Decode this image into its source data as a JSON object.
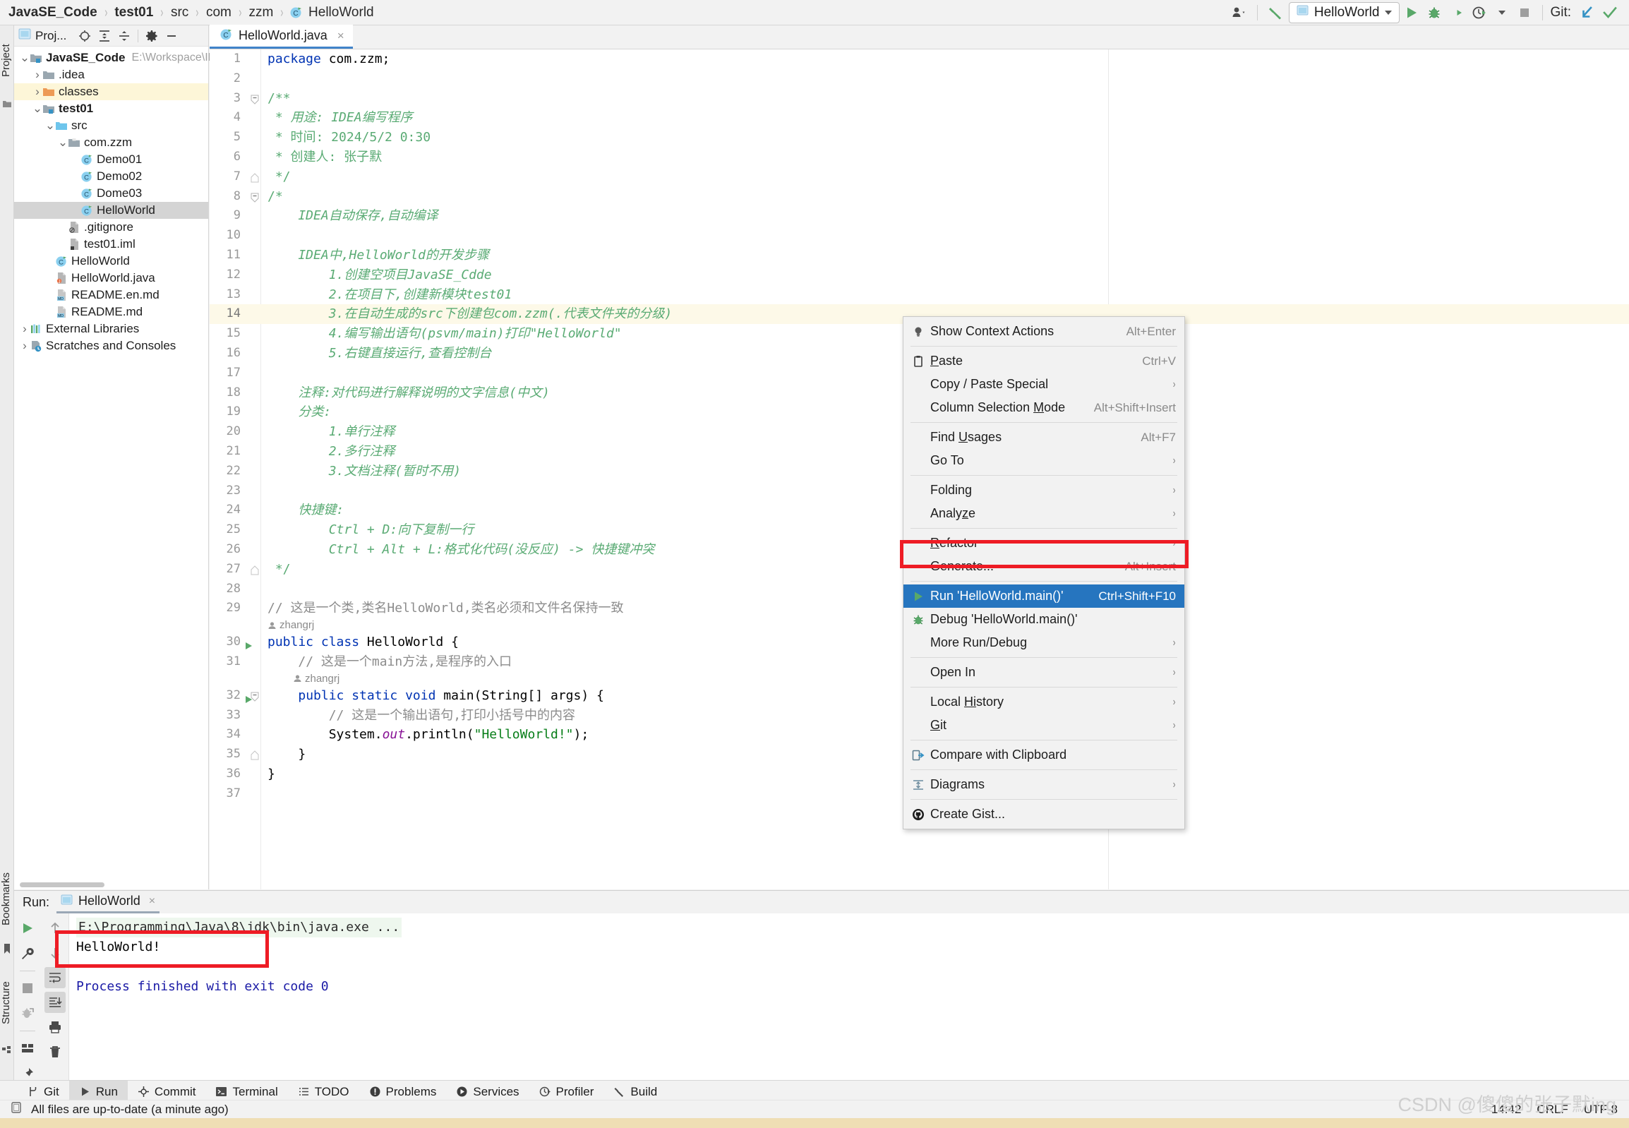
{
  "breadcrumb": {
    "items": [
      {
        "label": "JavaSE_Code",
        "bold": true,
        "icon": ""
      },
      {
        "label": "test01",
        "bold": true,
        "icon": ""
      },
      {
        "label": "src",
        "bold": false,
        "icon": ""
      },
      {
        "label": "com",
        "bold": false,
        "icon": ""
      },
      {
        "label": "zzm",
        "bold": false,
        "icon": ""
      },
      {
        "label": "HelloWorld",
        "bold": false,
        "icon": "java-class-icon"
      }
    ]
  },
  "toolbar": {
    "avatar_icon": "user-dropdown-icon",
    "build_icon": "build-hammer-icon",
    "run_config_name": "HelloWorld",
    "run_config_icon": "run-config-icon",
    "run_icon": "run-play-icon",
    "debug_icon": "debug-bug-icon",
    "run_coverage_icon": "run-with-coverage-icon",
    "profiler_icon": "profiler-icon",
    "stop_icon": "stop-icon",
    "git_label": "Git:",
    "git_update_icon": "git-update-arrow-icon",
    "git_commit_icon": "git-commit-check-icon"
  },
  "left_strip": {
    "project_label": "Project",
    "bookmarks_label": "Bookmarks",
    "structure_label": "Structure"
  },
  "project_panel": {
    "title": "Proj...",
    "title_icon": "project-window-icon",
    "buttons": [
      {
        "name": "select-opened-file-icon",
        "glyph": "target"
      },
      {
        "name": "expand-all-icon",
        "glyph": "expand"
      },
      {
        "name": "collapse-all-icon",
        "glyph": "collapse"
      },
      {
        "name": "settings-gear-icon",
        "glyph": "gear"
      },
      {
        "name": "hide-panel-icon",
        "glyph": "minus"
      }
    ],
    "tree": [
      {
        "indent": 0,
        "arrow": "down",
        "icon": "module-folder-icon",
        "label": "JavaSE_Code",
        "bold": true,
        "path": "E:\\Workspace\\ID",
        "state": "normal"
      },
      {
        "indent": 1,
        "arrow": "right",
        "icon": "folder-icon",
        "label": ".idea",
        "bold": false,
        "path": "",
        "state": "normal"
      },
      {
        "indent": 1,
        "arrow": "right",
        "icon": "output-folder-icon",
        "label": "classes",
        "bold": false,
        "path": "",
        "state": "highlight"
      },
      {
        "indent": 1,
        "arrow": "down",
        "icon": "module-folder-icon",
        "label": "test01",
        "bold": true,
        "path": "",
        "state": "normal"
      },
      {
        "indent": 2,
        "arrow": "down",
        "icon": "source-folder-icon",
        "label": "src",
        "bold": false,
        "path": "",
        "state": "normal"
      },
      {
        "indent": 3,
        "arrow": "down",
        "icon": "package-icon",
        "label": "com.zzm",
        "bold": false,
        "path": "",
        "state": "normal"
      },
      {
        "indent": 4,
        "arrow": "none",
        "icon": "java-class-icon",
        "label": "Demo01",
        "bold": false,
        "path": "",
        "state": "normal"
      },
      {
        "indent": 4,
        "arrow": "none",
        "icon": "java-class-icon",
        "label": "Demo02",
        "bold": false,
        "path": "",
        "state": "normal"
      },
      {
        "indent": 4,
        "arrow": "none",
        "icon": "java-class-icon",
        "label": "Dome03",
        "bold": false,
        "path": "",
        "state": "normal"
      },
      {
        "indent": 4,
        "arrow": "none",
        "icon": "java-class-icon",
        "label": "HelloWorld",
        "bold": false,
        "path": "",
        "state": "selected"
      },
      {
        "indent": 3,
        "arrow": "none",
        "icon": "gitignore-file-icon",
        "label": ".gitignore",
        "bold": false,
        "path": "",
        "state": "normal"
      },
      {
        "indent": 3,
        "arrow": "none",
        "icon": "iml-file-icon",
        "label": "test01.iml",
        "bold": false,
        "path": "",
        "state": "normal"
      },
      {
        "indent": 2,
        "arrow": "none",
        "icon": "java-class-icon",
        "label": "HelloWorld",
        "bold": false,
        "path": "",
        "state": "normal"
      },
      {
        "indent": 2,
        "arrow": "none",
        "icon": "java-file-icon",
        "label": "HelloWorld.java",
        "bold": false,
        "path": "",
        "state": "normal"
      },
      {
        "indent": 2,
        "arrow": "none",
        "icon": "markdown-file-icon",
        "label": "README.en.md",
        "bold": false,
        "path": "",
        "state": "normal"
      },
      {
        "indent": 2,
        "arrow": "none",
        "icon": "markdown-file-icon",
        "label": "README.md",
        "bold": false,
        "path": "",
        "state": "normal"
      },
      {
        "indent": 0,
        "arrow": "right",
        "icon": "external-libraries-icon",
        "label": "External Libraries",
        "bold": false,
        "path": "",
        "state": "normal"
      },
      {
        "indent": 0,
        "arrow": "right",
        "icon": "scratches-icon",
        "label": "Scratches and Consoles",
        "bold": false,
        "path": "",
        "state": "normal"
      }
    ]
  },
  "editor": {
    "tab": {
      "label": "HelloWorld.java",
      "icon": "java-class-icon",
      "close": "×"
    },
    "lines": [
      {
        "n": "1",
        "html": "<span class=\"kw\">package</span> <span class=\"pkg\">com.zzm;</span>"
      },
      {
        "n": "2",
        "html": ""
      },
      {
        "n": "3",
        "html": "<span class=\"doc2\">/**</span>",
        "fold": "minus"
      },
      {
        "n": "4",
        "html": "<span class=\"doc2\"> * </span><span class=\"doc\">用途: IDEA编写程序</span>"
      },
      {
        "n": "5",
        "html": "<span class=\"doc2\"> * 时间: 2024/5/2 0:30</span>"
      },
      {
        "n": "6",
        "html": "<span class=\"doc2\"> * 创建人: 张子默</span>"
      },
      {
        "n": "7",
        "html": "<span class=\"doc2\"> */</span>",
        "fold": "end"
      },
      {
        "n": "8",
        "html": "<span class=\"doc2\">/*</span>",
        "fold": "minus"
      },
      {
        "n": "9",
        "html": "<span class=\"doc\">    IDEA自动保存,自动编译</span>"
      },
      {
        "n": "10",
        "html": ""
      },
      {
        "n": "11",
        "html": "<span class=\"doc\">    IDEA中,HelloWorld的开发步骤</span>"
      },
      {
        "n": "12",
        "html": "<span class=\"doc\">        1.创建空项目JavaSE_Cdde</span>"
      },
      {
        "n": "13",
        "html": "<span class=\"doc\">        2.在项目下,创建新模块test01</span>"
      },
      {
        "n": "14",
        "html": "<span class=\"doc\">        3.在自动生成的src下创建包com.zzm(.代表文件夹的分级)</span>",
        "highlight": true
      },
      {
        "n": "15",
        "html": "<span class=\"doc\">        4.编写输出语句(psvm/main)打印\"HelloWorld\"</span>"
      },
      {
        "n": "16",
        "html": "<span class=\"doc\">        5.右键直接运行,查看控制台</span>"
      },
      {
        "n": "17",
        "html": ""
      },
      {
        "n": "18",
        "html": "<span class=\"doc\">    注释:对代码进行解释说明的文字信息(中文)</span>"
      },
      {
        "n": "19",
        "html": "<span class=\"doc\">    分类:</span>"
      },
      {
        "n": "20",
        "html": "<span class=\"doc\">        1.单行注释</span>"
      },
      {
        "n": "21",
        "html": "<span class=\"doc\">        2.多行注释</span>"
      },
      {
        "n": "22",
        "html": "<span class=\"doc\">        3.文档注释(暂时不用)</span>"
      },
      {
        "n": "23",
        "html": ""
      },
      {
        "n": "24",
        "html": "<span class=\"doc\">    快捷键:</span>"
      },
      {
        "n": "25",
        "html": "<span class=\"doc\">        Ctrl + D:向下复制一行</span>"
      },
      {
        "n": "26",
        "html": "<span class=\"doc\">        Ctrl + Alt + L:格式化代码(没反应) -&gt; 快捷键冲突</span>"
      },
      {
        "n": "27",
        "html": "<span class=\"doc2\"> */</span>",
        "fold": "end"
      },
      {
        "n": "28",
        "html": ""
      },
      {
        "n": "29",
        "html": "<span class=\"cmt\">// </span><span class=\"cmt\">这是一个类,类名HelloWorld,类名必须和文件名保持一致</span>"
      },
      {
        "n": "",
        "annot": "zhangrj"
      },
      {
        "n": "30",
        "html": "<span class=\"kw\">public class</span> <span class=\"plain\">HelloWorld {</span>",
        "run": true
      },
      {
        "n": "31",
        "html": "    <span class=\"cmt\">// 这是一个main方法,是程序的入口</span>"
      },
      {
        "n": "",
        "annot": "zhangrj",
        "annotIndent": 1
      },
      {
        "n": "32",
        "html": "    <span class=\"kw\">public static void</span> <span class=\"plain\">main(String[] args) {</span>",
        "run": true,
        "fold": "minus"
      },
      {
        "n": "33",
        "html": "        <span class=\"cmt\">// 这是一个输出语句,打印小括号中的内容</span>"
      },
      {
        "n": "34",
        "html": "        <span class=\"plain\">System.</span><span class=\"fld\">out</span><span class=\"plain\">.println(</span><span class=\"str\">\"HelloWorld!\"</span><span class=\"plain\">);</span>"
      },
      {
        "n": "35",
        "html": "    <span class=\"plain\">}</span>",
        "fold": "end"
      },
      {
        "n": "36",
        "html": "<span class=\"plain\">}</span>"
      },
      {
        "n": "37",
        "html": ""
      }
    ]
  },
  "context_menu": {
    "items": [
      {
        "type": "item",
        "icon": "lightbulb-icon",
        "label": "Show Context Actions",
        "shortcut": "Alt+Enter",
        "arrow": false,
        "selected": false
      },
      {
        "type": "separator"
      },
      {
        "type": "item",
        "icon": "paste-clipboard-icon",
        "label": "Paste",
        "shortcut": "Ctrl+V",
        "arrow": false,
        "selected": false,
        "mnemonic": "P"
      },
      {
        "type": "item",
        "icon": "",
        "label": "Copy / Paste Special",
        "shortcut": "",
        "arrow": true,
        "selected": false
      },
      {
        "type": "item",
        "icon": "",
        "label": "Column Selection Mode",
        "shortcut": "Alt+Shift+Insert",
        "arrow": false,
        "selected": false,
        "mnemonic": "M"
      },
      {
        "type": "separator"
      },
      {
        "type": "item",
        "icon": "",
        "label": "Find Usages",
        "shortcut": "Alt+F7",
        "arrow": false,
        "selected": false,
        "mnemonic": "U"
      },
      {
        "type": "item",
        "icon": "",
        "label": "Go To",
        "shortcut": "",
        "arrow": true,
        "selected": false
      },
      {
        "type": "separator"
      },
      {
        "type": "item",
        "icon": "",
        "label": "Folding",
        "shortcut": "",
        "arrow": true,
        "selected": false
      },
      {
        "type": "item",
        "icon": "",
        "label": "Analyze",
        "shortcut": "",
        "arrow": true,
        "selected": false,
        "mnemonic": "z"
      },
      {
        "type": "separator"
      },
      {
        "type": "item",
        "icon": "",
        "label": "Refactor",
        "shortcut": "",
        "arrow": true,
        "selected": false,
        "mnemonic": "R"
      },
      {
        "type": "item",
        "icon": "",
        "label": "Generate...",
        "shortcut": "Alt+Insert",
        "arrow": false,
        "selected": false
      },
      {
        "type": "separator"
      },
      {
        "type": "item",
        "icon": "run-play-icon",
        "label": "Run 'HelloWorld.main()'",
        "shortcut": "Ctrl+Shift+F10",
        "arrow": false,
        "selected": true
      },
      {
        "type": "item",
        "icon": "debug-bug-icon",
        "label": "Debug 'HelloWorld.main()'",
        "shortcut": "",
        "arrow": false,
        "selected": false
      },
      {
        "type": "item",
        "icon": "",
        "label": "More Run/Debug",
        "shortcut": "",
        "arrow": true,
        "selected": false
      },
      {
        "type": "separator"
      },
      {
        "type": "item",
        "icon": "",
        "label": "Open In",
        "shortcut": "",
        "arrow": true,
        "selected": false
      },
      {
        "type": "separator"
      },
      {
        "type": "item",
        "icon": "",
        "label": "Local History",
        "shortcut": "",
        "arrow": true,
        "selected": false,
        "mnemonic": "Hi"
      },
      {
        "type": "item",
        "icon": "",
        "label": "Git",
        "shortcut": "",
        "arrow": true,
        "selected": false,
        "mnemonic": "G"
      },
      {
        "type": "separator"
      },
      {
        "type": "item",
        "icon": "compare-clipboard-icon",
        "label": "Compare with Clipboard",
        "shortcut": "",
        "arrow": false,
        "selected": false
      },
      {
        "type": "separator"
      },
      {
        "type": "item",
        "icon": "diagrams-icon",
        "label": "Diagrams",
        "shortcut": "",
        "arrow": true,
        "selected": false
      },
      {
        "type": "separator"
      },
      {
        "type": "item",
        "icon": "github-icon",
        "label": "Create Gist...",
        "shortcut": "",
        "arrow": false,
        "selected": false
      }
    ]
  },
  "run_window": {
    "label": "Run:",
    "tab": {
      "label": "HelloWorld",
      "icon": "run-config-icon",
      "close": "×"
    },
    "left_tools": [
      {
        "name": "rerun-icon"
      },
      {
        "name": "edit-configuration-wrench-icon"
      },
      {
        "name": "stop-icon"
      },
      {
        "name": "resume-program-icon"
      },
      {
        "name": "layout-settings-icon"
      },
      {
        "name": "pin-tab-icon"
      }
    ],
    "console_tools": [
      {
        "name": "scroll-up-icon"
      },
      {
        "name": "scroll-down-icon"
      },
      {
        "name": "soft-wrap-icon",
        "active": true
      },
      {
        "name": "scroll-to-end-icon",
        "active": true
      },
      {
        "name": "print-icon"
      },
      {
        "name": "clear-all-trash-icon"
      }
    ],
    "console": {
      "command": "E:\\Programming\\Java\\8\\jdk\\bin\\java.exe ...",
      "output": "HelloWorld!",
      "finished": "Process finished with exit code 0"
    }
  },
  "bottom_bar": {
    "items": [
      {
        "label": "Git",
        "icon": "git-branch-icon",
        "active": false
      },
      {
        "label": "Run",
        "icon": "run-play-icon",
        "active": true
      },
      {
        "label": "Commit",
        "icon": "commit-icon",
        "active": false
      },
      {
        "label": "Terminal",
        "icon": "terminal-icon",
        "active": false
      },
      {
        "label": "TODO",
        "icon": "todo-list-icon",
        "active": false
      },
      {
        "label": "Problems",
        "icon": "problems-icon",
        "active": false
      },
      {
        "label": "Services",
        "icon": "services-icon",
        "active": false
      },
      {
        "label": "Profiler",
        "icon": "profiler-icon",
        "active": false
      },
      {
        "label": "Build",
        "icon": "build-hammer-icon",
        "active": false
      }
    ]
  },
  "status_bar": {
    "icon": "memory-indicator-icon",
    "message": "All files are up-to-date (a minute ago)",
    "time": "14:42",
    "line_separator": "CRLF",
    "encoding": "UTF-8"
  },
  "watermark": "CSDN @傻傻的张子默ing",
  "colors": {
    "accent_blue": "#2675bf",
    "red_highlight": "#ee1c25",
    "comment_green": "#5aab74",
    "keyword_blue": "#0033b3",
    "string_green": "#067d17",
    "selection_gray": "#d4d4d4"
  }
}
